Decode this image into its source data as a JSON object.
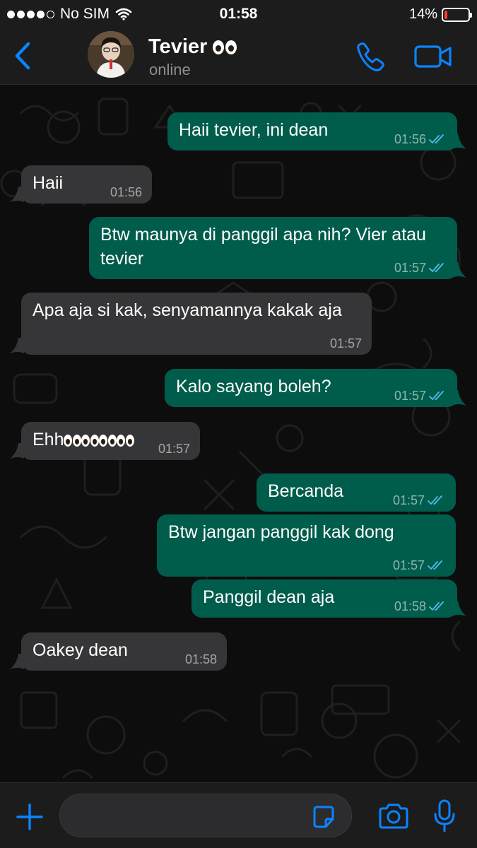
{
  "status_bar": {
    "carrier": "No SIM",
    "time": "01:58",
    "battery_percent": "14%",
    "battery_level": 0.14
  },
  "header": {
    "contact_name": "Tevier",
    "contact_status": "online",
    "name_emoji": "eyes-emoji"
  },
  "messages": [
    {
      "dir": "out",
      "text": "Haii tevier, ini dean",
      "time": "01:56",
      "read": true
    },
    {
      "dir": "in",
      "text": "Haii",
      "time": "01:56"
    },
    {
      "dir": "out",
      "text": "Btw maunya di panggil apa nih? Vier atau tevier",
      "time": "01:57",
      "read": true
    },
    {
      "dir": "in",
      "text": "Apa aja si kak, senyamannya kakak aja",
      "time": "01:57"
    },
    {
      "dir": "out",
      "text": "Kalo sayang boleh?",
      "time": "01:57",
      "read": true
    },
    {
      "dir": "in",
      "text": "Ehh",
      "time": "01:57",
      "emoji": "eyes-emoji x4"
    },
    {
      "dir": "out",
      "text": "Bercanda",
      "time": "01:57",
      "read": true
    },
    {
      "dir": "out",
      "text": "Btw jangan panggil kak dong",
      "time": "01:57",
      "read": true
    },
    {
      "dir": "out",
      "text": "Panggil dean aja",
      "time": "01:58",
      "read": true
    },
    {
      "dir": "in",
      "text": "Oakey dean",
      "time": "01:58"
    }
  ],
  "input": {
    "value": "",
    "placeholder": ""
  },
  "colors": {
    "accent": "#0a84ff",
    "outgoing_bubble": "#005c4b",
    "incoming_bubble": "#363638",
    "read_ticks": "#53bdeb",
    "battery_low": "#ff3b30"
  },
  "icons": [
    "back-chevron-icon",
    "phone-icon",
    "video-camera-icon",
    "plus-icon",
    "sticker-icon",
    "camera-icon",
    "microphone-icon",
    "double-check-icon"
  ]
}
